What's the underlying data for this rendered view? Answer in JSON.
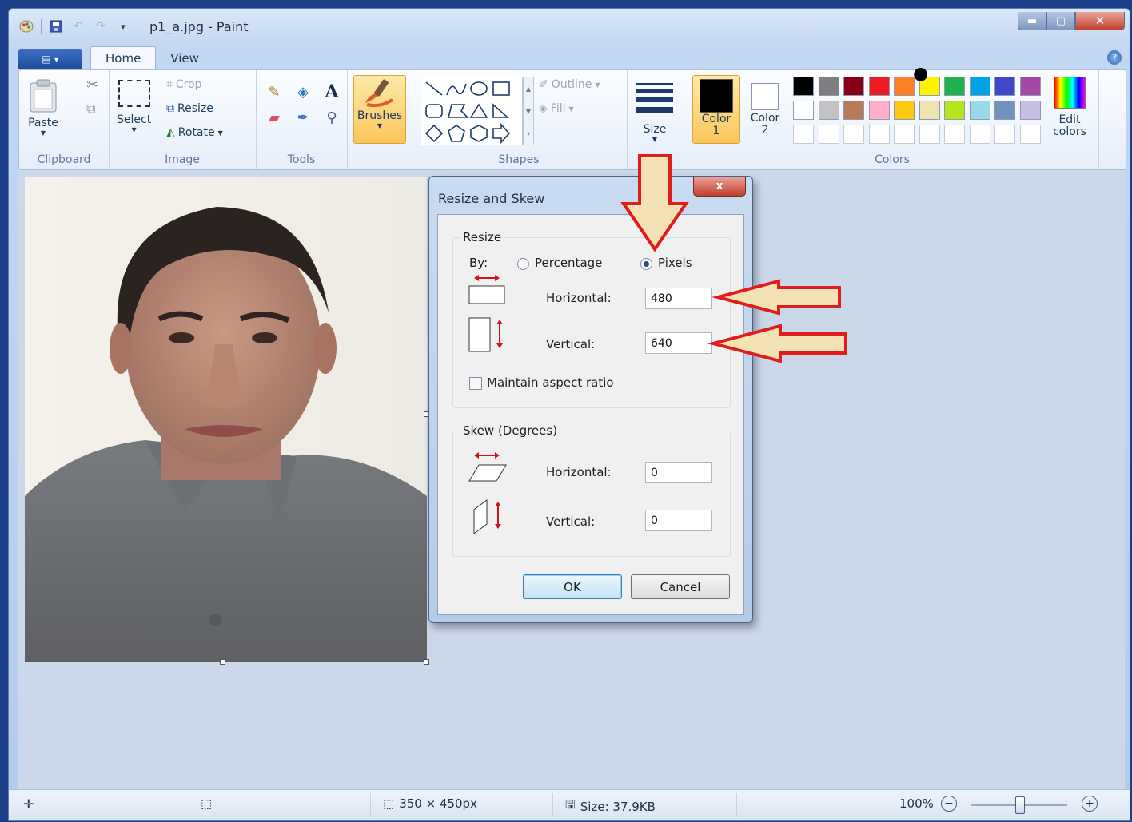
{
  "window": {
    "title": "p1_a.jpg - Paint"
  },
  "tabs": {
    "home": "Home",
    "view": "View"
  },
  "ribbon": {
    "clipboard": {
      "paste": "Paste",
      "label": "Clipboard"
    },
    "image": {
      "select": "Select",
      "crop": "Crop",
      "resize": "Resize",
      "rotate": "Rotate",
      "label": "Image"
    },
    "tools": {
      "label": "Tools"
    },
    "brushes": {
      "label": "Brushes"
    },
    "shapes": {
      "outline": "Outline",
      "fill": "Fill",
      "label": "Shapes"
    },
    "size": {
      "label": "Size"
    },
    "colors": {
      "color1_a": "Color",
      "color1_b": "1",
      "color2_a": "Color",
      "color2_b": "2",
      "edit_a": "Edit",
      "edit_b": "colors",
      "label": "Colors",
      "color1": "#000000",
      "color2": "#ffffff",
      "palette_row1": [
        "#000000",
        "#7f7f7f",
        "#880015",
        "#ed1c24",
        "#ff7f27",
        "#fff200",
        "#22b14c",
        "#00a2e8",
        "#3f48cc",
        "#a349a4"
      ],
      "palette_row2": [
        "#ffffff",
        "#c3c3c3",
        "#b97a57",
        "#ffaec9",
        "#ffc90e",
        "#efe4b0",
        "#b5e61d",
        "#99d9ea",
        "#7092be",
        "#c8bfe7"
      ]
    }
  },
  "dialog": {
    "title": "Resize and Skew",
    "close": "x",
    "resize_legend": "Resize",
    "by_label": "By:",
    "percentage": "Percentage",
    "pixels": "Pixels",
    "horizontal_label": "Horizontal:",
    "horizontal_value": "480",
    "vertical_label": "Vertical:",
    "vertical_value": "640",
    "maintain": "Maintain aspect ratio",
    "skew_legend": "Skew (Degrees)",
    "skew_horizontal_label": "Horizontal:",
    "skew_horizontal_value": "0",
    "skew_vertical_label": "Vertical:",
    "skew_vertical_value": "0",
    "ok": "OK",
    "cancel": "Cancel"
  },
  "status": {
    "dimensions": "350 × 450px",
    "size": "Size: 37.9KB",
    "zoom": "100%"
  },
  "colors": {
    "arrow_fill": "#f3e2b3",
    "arrow_stroke": "#e11c1c"
  }
}
